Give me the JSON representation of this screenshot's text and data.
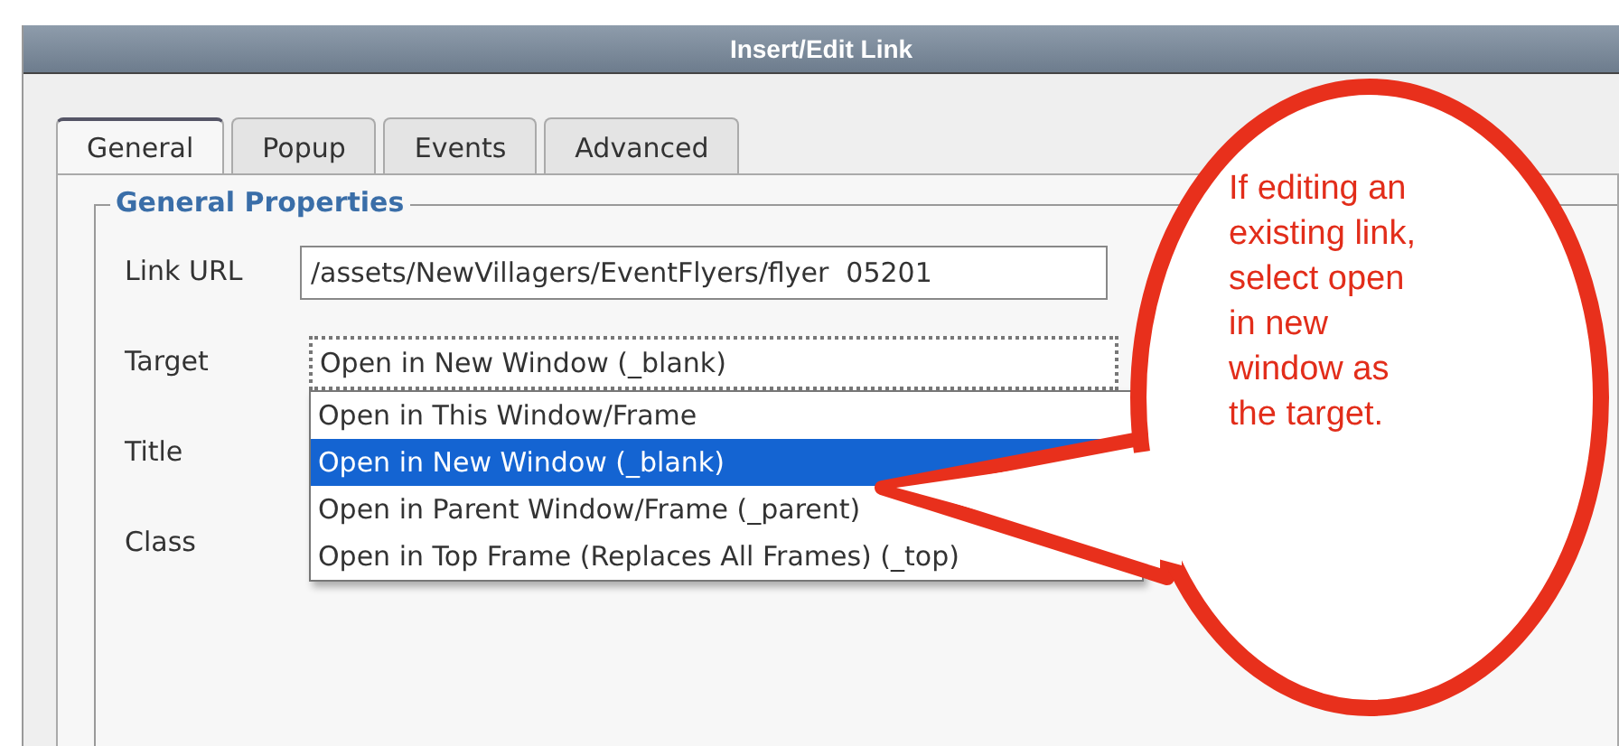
{
  "window": {
    "title": "Insert/Edit Link"
  },
  "tabs": [
    {
      "label": "General",
      "selected": true
    },
    {
      "label": "Popup",
      "selected": false
    },
    {
      "label": "Events",
      "selected": false
    },
    {
      "label": "Advanced",
      "selected": false
    }
  ],
  "fieldset": {
    "legend": "General Properties"
  },
  "fields": [
    {
      "label": "Link URL",
      "kind": "text",
      "value": "/assets/NewVillagers/EventFlyers/flyer  05201"
    },
    {
      "label": "Target",
      "kind": "select",
      "value": "Open in New Window (_blank)",
      "expanded": true,
      "options": [
        {
          "label": "Open in This Window/Frame",
          "selected": false
        },
        {
          "label": "Open in New Window (_blank)",
          "selected": true
        },
        {
          "label": "Open in Parent Window/Frame (_parent)",
          "selected": false
        },
        {
          "label": "Open in Top Frame (Replaces All Frames) (_top)",
          "selected": false
        }
      ]
    },
    {
      "label": "Title",
      "kind": "text"
    },
    {
      "label": "Class",
      "kind": "text"
    }
  ],
  "callout": {
    "text": "If editing an\nexisting link,\nselect open\nin new\nwindow as\nthe target."
  }
}
